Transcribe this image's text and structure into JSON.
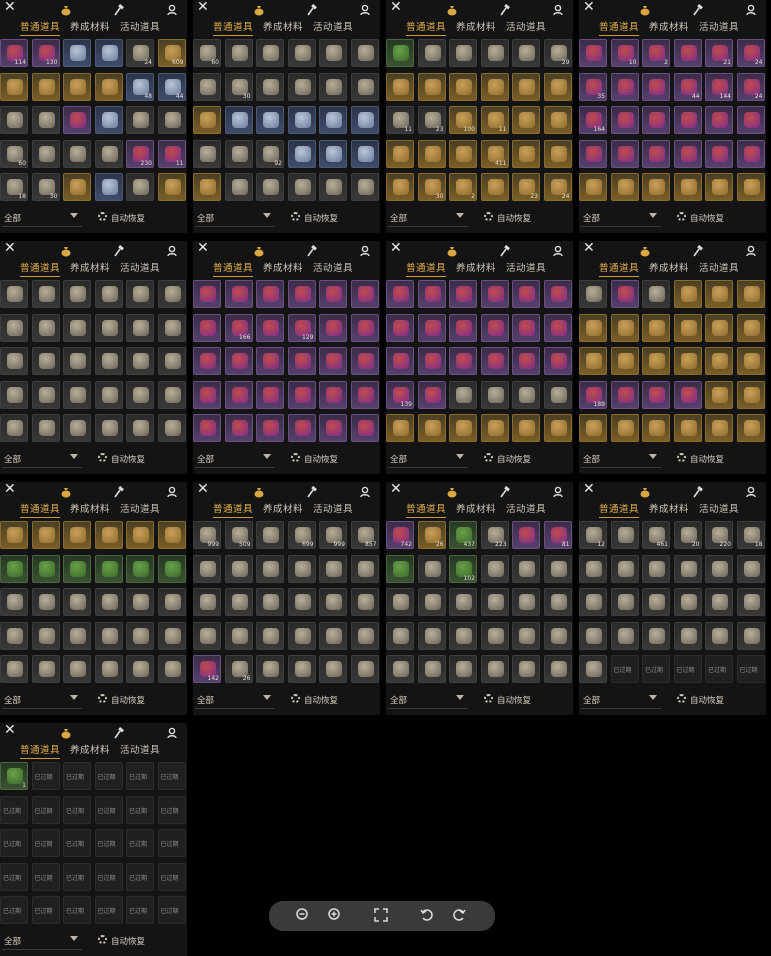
{
  "tabs": [
    "普通道具",
    "养成材料",
    "活动道具"
  ],
  "filter_label": "全部",
  "restore_label": "自动恢复",
  "expired_label": "已过期",
  "icons": {
    "close": "close-icon",
    "bag": "money-bag-icon",
    "hammer": "hammer-icon",
    "profile": "user-icon",
    "filter_caret": "chevron-down-icon",
    "restore": "gear-icon"
  },
  "colors": {
    "accent": "#e6b24a",
    "panel_bg": "#141414",
    "page_bg": "#000000"
  },
  "panels": [
    {
      "rarity": [
        "purple",
        "purple",
        "blue",
        "blue",
        "gray",
        "gold",
        "gold",
        "gold",
        "gold",
        "gold",
        "blue",
        "blue",
        "gray",
        "gray",
        "purple",
        "blue",
        "gray",
        "gray",
        "gray",
        "gray",
        "gray",
        "gray",
        "purple",
        "purple",
        "gray",
        "gray",
        "gold",
        "blue",
        "gray",
        "gold"
      ],
      "counts": [
        "114",
        "130",
        "",
        "",
        "24",
        "609",
        "",
        "",
        "",
        "",
        "48",
        "44",
        "",
        "",
        "",
        "",
        "",
        "",
        "60",
        "",
        "",
        "",
        "230",
        "11",
        "18",
        "30",
        "",
        "",
        "",
        ""
      ]
    },
    {
      "rarity": [
        "gray",
        "gray",
        "gray",
        "gray",
        "gray",
        "gray",
        "gray",
        "gray",
        "gray",
        "gray",
        "gray",
        "gray",
        "gold",
        "blue",
        "blue",
        "blue",
        "blue",
        "blue",
        "gray",
        "gray",
        "gray",
        "blue",
        "blue",
        "blue",
        "gold",
        "gray",
        "gray",
        "gray",
        "gray",
        "gray"
      ],
      "counts": [
        "60",
        "",
        "",
        "",
        "",
        "",
        "",
        "30",
        "",
        "",
        "",
        "",
        "",
        "",
        "",
        "",
        "",
        "",
        "",
        "",
        "92",
        "",
        "",
        "",
        "",
        "",
        "",
        "",
        "",
        ""
      ]
    },
    {
      "rarity": [
        "green",
        "gray",
        "gray",
        "gray",
        "gray",
        "gray",
        "gold",
        "gold",
        "gold",
        "gold",
        "gold",
        "gold",
        "gray",
        "gray",
        "gold",
        "gold",
        "gold",
        "gold",
        "gold",
        "gold",
        "gold",
        "gold",
        "gold",
        "gold",
        "gold",
        "gold",
        "gold",
        "gold",
        "gold",
        "gold"
      ],
      "counts": [
        "",
        "",
        "",
        "",
        "",
        "29",
        "",
        "",
        "",
        "",
        "",
        "",
        "11",
        "23",
        "100",
        "11",
        "",
        "",
        "",
        "",
        "",
        "411",
        "",
        "",
        "",
        "30",
        "2",
        "",
        "23",
        "24"
      ]
    },
    {
      "rarity": [
        "purple",
        "purple",
        "purple",
        "purple",
        "purple",
        "purple",
        "purple",
        "purple",
        "purple",
        "purple",
        "purple",
        "purple",
        "purple",
        "purple",
        "purple",
        "purple",
        "purple",
        "purple",
        "purple",
        "purple",
        "purple",
        "purple",
        "purple",
        "purple",
        "gold",
        "gold",
        "gold",
        "gold",
        "gold",
        "gold"
      ],
      "counts": [
        "",
        "10",
        "2",
        "",
        "21",
        "24",
        "35",
        "",
        "",
        "44",
        "144",
        "24",
        "164",
        "",
        "",
        "",
        "",
        "",
        "",
        "",
        "",
        "",
        "",
        "",
        "",
        "",
        "",
        "",
        "",
        ""
      ]
    },
    {
      "rarity": [
        "gray",
        "gray",
        "gray",
        "gray",
        "gray",
        "gray",
        "gray",
        "gray",
        "gray",
        "gray",
        "gray",
        "gray",
        "gray",
        "gray",
        "gray",
        "gray",
        "gray",
        "gray",
        "gray",
        "gray",
        "gray",
        "gray",
        "gray",
        "gray",
        "gray",
        "gray",
        "gray",
        "gray",
        "gray",
        "gray"
      ],
      "counts": [
        "",
        "",
        "",
        "",
        "",
        "",
        "",
        "",
        "",
        "",
        "",
        "",
        "",
        "",
        "",
        "",
        "",
        "",
        "",
        "",
        "",
        "",
        "",
        "",
        "",
        "",
        "",
        "",
        "",
        ""
      ]
    },
    {
      "rarity": [
        "purple",
        "purple",
        "purple",
        "purple",
        "purple",
        "purple",
        "purple",
        "purple",
        "purple",
        "purple",
        "purple",
        "purple",
        "purple",
        "purple",
        "purple",
        "purple",
        "purple",
        "purple",
        "purple",
        "purple",
        "purple",
        "purple",
        "purple",
        "purple",
        "purple",
        "purple",
        "purple",
        "purple",
        "purple",
        "purple"
      ],
      "counts": [
        "",
        "",
        "",
        "",
        "",
        "",
        "",
        "166",
        "",
        "129",
        "",
        "",
        "",
        "",
        "",
        "",
        "",
        "",
        "",
        "",
        "",
        "",
        "",
        "",
        "",
        "",
        "",
        "",
        "",
        ""
      ]
    },
    {
      "rarity": [
        "purple",
        "purple",
        "purple",
        "purple",
        "purple",
        "purple",
        "purple",
        "purple",
        "purple",
        "purple",
        "purple",
        "purple",
        "purple",
        "purple",
        "purple",
        "purple",
        "purple",
        "purple",
        "purple",
        "purple",
        "gray",
        "gray",
        "gray",
        "gray",
        "gold",
        "gold",
        "gold",
        "gold",
        "gold",
        "gold"
      ],
      "counts": [
        "",
        "",
        "",
        "",
        "",
        "",
        "",
        "",
        "",
        "",
        "",
        "",
        "",
        "",
        "",
        "",
        "",
        "",
        "139",
        "",
        "",
        "",
        "",
        "",
        "",
        "",
        "",
        "",
        "",
        ""
      ]
    },
    {
      "rarity": [
        "gray",
        "purple",
        "gray",
        "gold",
        "gold",
        "gold",
        "gold",
        "gold",
        "gold",
        "gold",
        "gold",
        "gold",
        "gold",
        "gold",
        "gold",
        "gold",
        "gold",
        "gold",
        "purple",
        "purple",
        "purple",
        "purple",
        "gold",
        "gold",
        "gold",
        "gold",
        "gold",
        "gold",
        "gold",
        "gold"
      ],
      "counts": [
        "",
        "",
        "",
        "",
        "",
        "",
        "",
        "",
        "",
        "",
        "",
        "",
        "",
        "",
        "",
        "",
        "",
        "",
        "189",
        "",
        "",
        "",
        "",
        "",
        "",
        "",
        "",
        "",
        "",
        ""
      ]
    },
    {
      "rarity": [
        "gold",
        "gold",
        "gold",
        "gold",
        "gold",
        "gold",
        "green",
        "green",
        "green",
        "green",
        "green",
        "green",
        "gray",
        "gray",
        "gray",
        "gray",
        "gray",
        "gray",
        "gray",
        "gray",
        "gray",
        "gray",
        "gray",
        "gray",
        "gray",
        "gray",
        "gray",
        "gray",
        "gray",
        "gray"
      ],
      "counts": [
        "",
        "",
        "",
        "",
        "",
        "",
        "",
        "",
        "",
        "",
        "",
        "",
        "",
        "",
        "",
        "",
        "",
        "",
        "",
        "",
        "",
        "",
        "",
        "",
        "",
        "",
        "",
        "",
        "",
        ""
      ]
    },
    {
      "rarity": [
        "gray",
        "gray",
        "gray",
        "gray",
        "gray",
        "gray",
        "gray",
        "gray",
        "gray",
        "gray",
        "gray",
        "gray",
        "gray",
        "gray",
        "gray",
        "gray",
        "gray",
        "gray",
        "gray",
        "gray",
        "gray",
        "gray",
        "gray",
        "gray",
        "purple",
        "gray",
        "gray",
        "gray",
        "gray",
        "gray"
      ],
      "counts": [
        "999",
        "509",
        "",
        "699",
        "999",
        "857",
        "",
        "",
        "",
        "",
        "",
        "",
        "",
        "",
        "",
        "",
        "",
        "",
        "",
        "",
        "",
        "",
        "",
        "",
        "142",
        "26",
        "",
        "",
        "",
        ""
      ]
    },
    {
      "rarity": [
        "purple",
        "gold",
        "green",
        "gray",
        "purple",
        "purple",
        "green",
        "gray",
        "green",
        "gray",
        "gray",
        "gray",
        "gray",
        "gray",
        "gray",
        "gray",
        "gray",
        "gray",
        "gray",
        "gray",
        "gray",
        "gray",
        "gray",
        "gray",
        "gray",
        "gray",
        "gray",
        "gray",
        "gray",
        "gray"
      ],
      "counts": [
        "742",
        "26",
        "437",
        "223",
        "",
        "81",
        "",
        "",
        "102",
        "",
        "",
        "",
        "",
        "",
        "",
        "",
        "",
        "",
        "",
        "",
        "",
        "",
        "",
        "",
        "",
        "",
        "",
        "",
        "",
        ""
      ]
    },
    {
      "rarity": [
        "gray",
        "gray",
        "gray",
        "gray",
        "gray",
        "gray",
        "gray",
        "gray",
        "gray",
        "gray",
        "gray",
        "gray",
        "gray",
        "gray",
        "gray",
        "gray",
        "gray",
        "gray",
        "gray",
        "gray",
        "gray",
        "gray",
        "gray",
        "gray",
        "gray",
        "empty",
        "empty",
        "empty",
        "empty",
        "empty"
      ],
      "counts": [
        "12",
        "",
        "461",
        "20",
        "220",
        "18",
        "",
        "",
        "",
        "",
        "",
        "",
        "",
        "",
        "",
        "",
        "",
        "",
        "",
        "",
        "",
        "",
        "",
        "",
        "",
        "",
        "",
        "",
        "",
        ""
      ],
      "expired_from": 25
    },
    {
      "rarity": [
        "green",
        "empty",
        "empty",
        "empty",
        "empty",
        "empty",
        "empty",
        "empty",
        "empty",
        "empty",
        "empty",
        "empty",
        "empty",
        "empty",
        "empty",
        "empty",
        "empty",
        "empty",
        "empty",
        "empty",
        "empty",
        "empty",
        "empty",
        "empty",
        "empty",
        "empty",
        "empty",
        "empty",
        "empty",
        "empty"
      ],
      "counts": [
        "1",
        "",
        "",
        "",
        "",
        "",
        "",
        "",
        "",
        "",
        "",
        "",
        "",
        "",
        "",
        "",
        "",
        "",
        "",
        "",
        "",
        "",
        "",
        "",
        "",
        "",
        "",
        "",
        "",
        ""
      ],
      "expired_from": 1
    }
  ]
}
